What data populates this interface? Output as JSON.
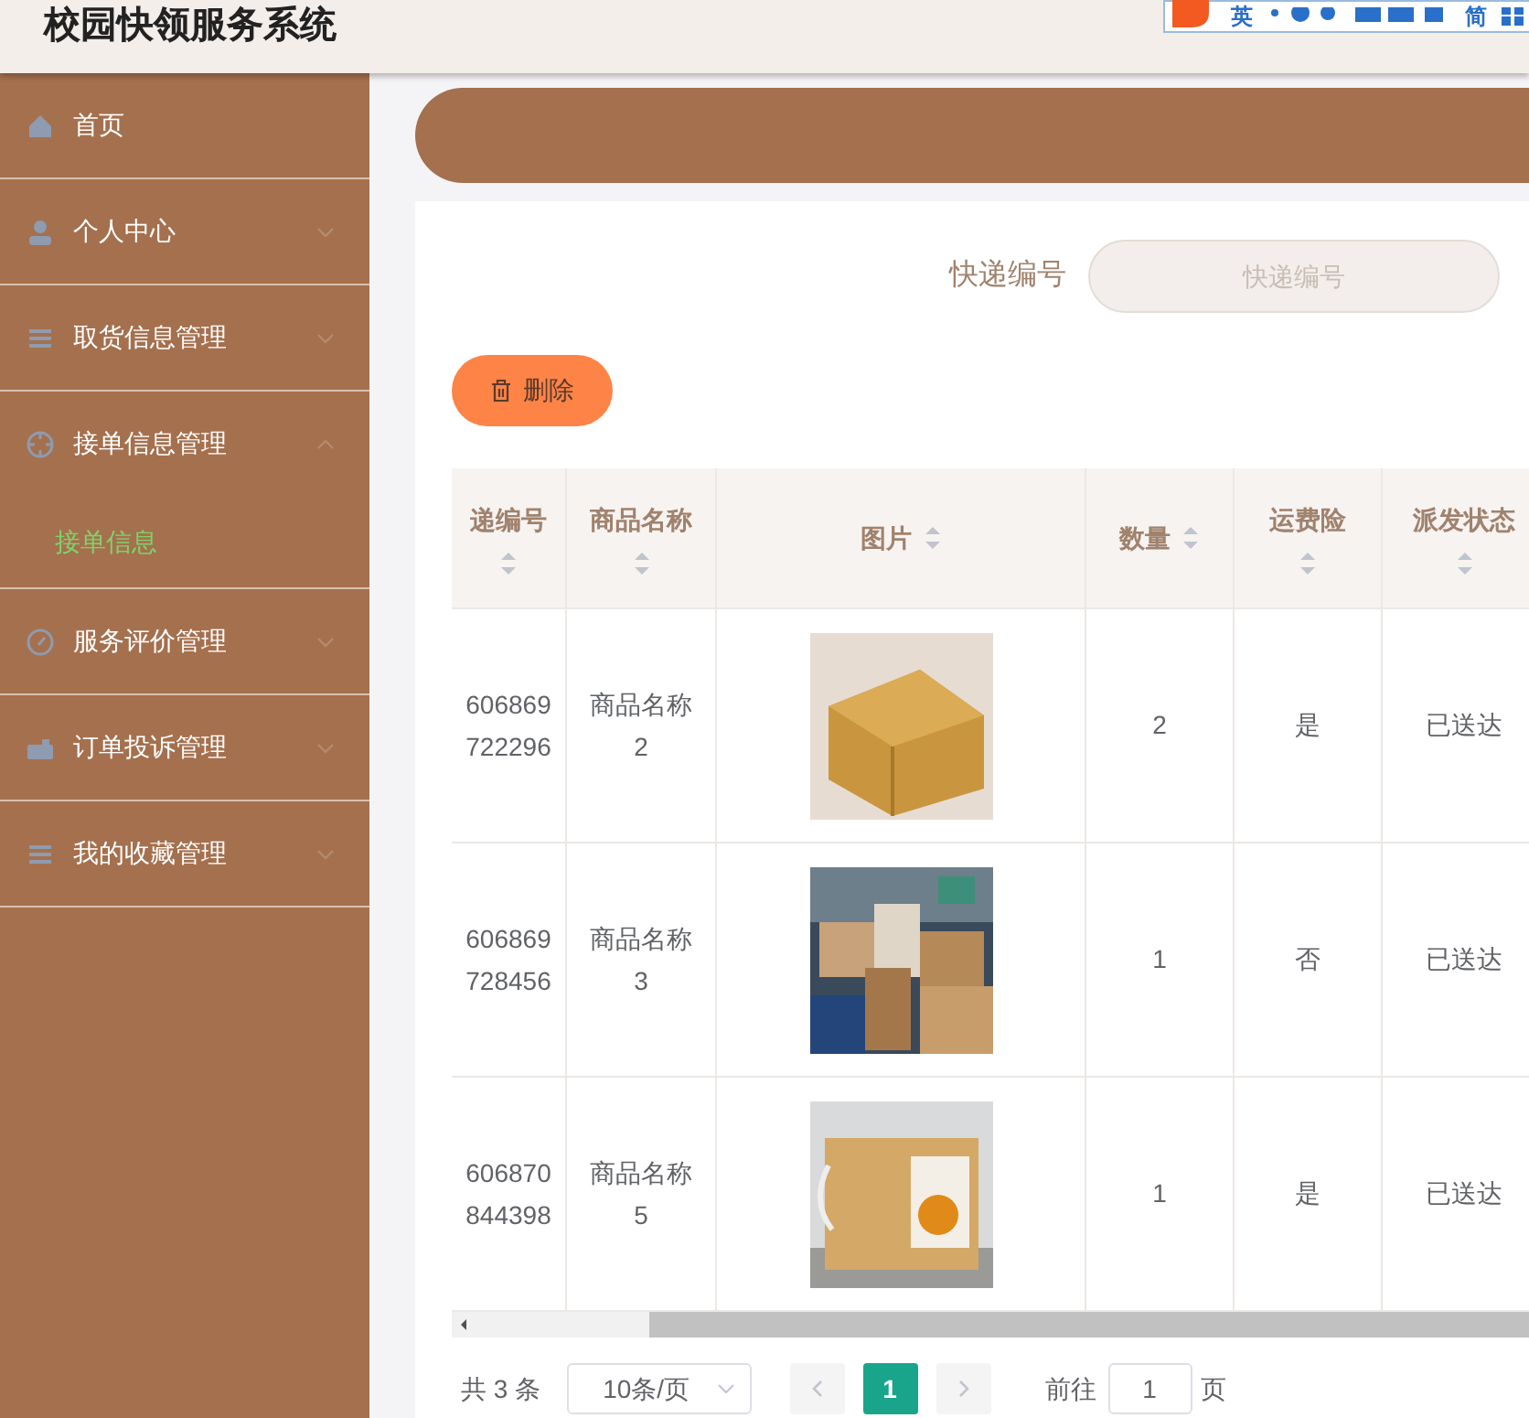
{
  "header": {
    "title": "校园快领服务系统",
    "ime_toolbar": {
      "mode": "英",
      "script": "简"
    }
  },
  "sidebar": {
    "items": [
      {
        "label": "首页",
        "kind": "home",
        "expandable": false
      },
      {
        "label": "个人中心",
        "kind": "user",
        "expandable": true,
        "expanded": false
      },
      {
        "label": "取货信息管理",
        "kind": "list",
        "expandable": true,
        "expanded": false
      },
      {
        "label": "接单信息管理",
        "kind": "target",
        "expandable": true,
        "expanded": true,
        "children": [
          {
            "label": "接单信息",
            "selected": true
          }
        ]
      },
      {
        "label": "服务评价管理",
        "kind": "compass",
        "expandable": true,
        "expanded": false
      },
      {
        "label": "订单投诉管理",
        "kind": "briefcase",
        "expandable": true,
        "expanded": false
      },
      {
        "label": "我的收藏管理",
        "kind": "list",
        "expandable": true,
        "expanded": false
      }
    ]
  },
  "search": {
    "label": "快递编号",
    "placeholder": "快递编号"
  },
  "actions": [
    {
      "label": "删除"
    }
  ],
  "table": {
    "columns": [
      {
        "label": "递编号",
        "sortable": true
      },
      {
        "label": "商品名称",
        "sortable": true
      },
      {
        "label": "图片",
        "sortable": true
      },
      {
        "label": "数量",
        "sortable": true
      },
      {
        "label": "运费险",
        "sortable": true
      },
      {
        "label": "派发状态",
        "sortable": true
      }
    ],
    "rows": [
      {
        "code": "606869722296",
        "name": "商品名称2",
        "quantity": "2",
        "insurance": "是",
        "status": "已送达"
      },
      {
        "code": "606869728456",
        "name": "商品名称3",
        "quantity": "1",
        "insurance": "否",
        "status": "已送达"
      },
      {
        "code": "606870844398",
        "name": "商品名称5",
        "quantity": "1",
        "insurance": "是",
        "status": "已送达"
      }
    ]
  },
  "pagination": {
    "total": "共 3 条",
    "page_size": "10条/页",
    "pages": [
      {
        "label": "1",
        "selected": true
      }
    ],
    "goto_label": "前往",
    "goto_value": "1",
    "goto_suffix": "页"
  }
}
